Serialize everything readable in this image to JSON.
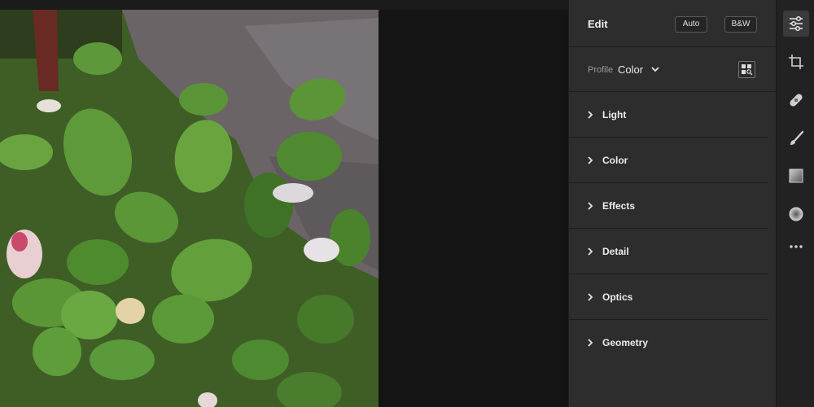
{
  "panel": {
    "title": "Edit",
    "auto_label": "Auto",
    "bw_label": "B&W",
    "profile_label": "Profile",
    "profile_value": "Color"
  },
  "sections": [
    {
      "label": "Light"
    },
    {
      "label": "Color"
    },
    {
      "label": "Effects"
    },
    {
      "label": "Detail"
    },
    {
      "label": "Optics"
    },
    {
      "label": "Geometry"
    }
  ],
  "toolbar": {
    "tools": [
      "edit-sliders-icon",
      "crop-icon",
      "healing-bandage-icon",
      "brush-icon",
      "linear-gradient-icon",
      "radial-gradient-icon",
      "more-icon"
    ],
    "active": "edit-sliders-icon"
  },
  "colors": {
    "panel_bg": "#2d2d2d",
    "app_bg": "#141414",
    "toolbar_bg": "#222222"
  }
}
